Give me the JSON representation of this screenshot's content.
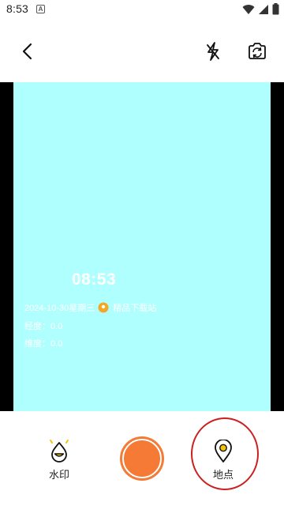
{
  "status_bar": {
    "time": "8:53",
    "notification_icon": "A",
    "icons": [
      "wifi-icon",
      "signal-icon",
      "battery-icon"
    ]
  },
  "toolbar": {
    "back_icon": "back-chevron-icon",
    "flash_icon": "flash-off-icon",
    "camera_switch_icon": "camera-switch-icon"
  },
  "watermark": {
    "time": "08:53",
    "date": "2024-10-30星期三",
    "location_name": "精品下载站",
    "longitude_label": "经度：0.0",
    "latitude_label": "维度：0.0"
  },
  "bottom_bar": {
    "watermark_label": "水印",
    "location_label": "地点"
  },
  "colors": {
    "preview_bg": "#b0ffff",
    "shutter": "#f47a35",
    "highlight": "#cc1f1f",
    "pin": "#f5a623"
  }
}
